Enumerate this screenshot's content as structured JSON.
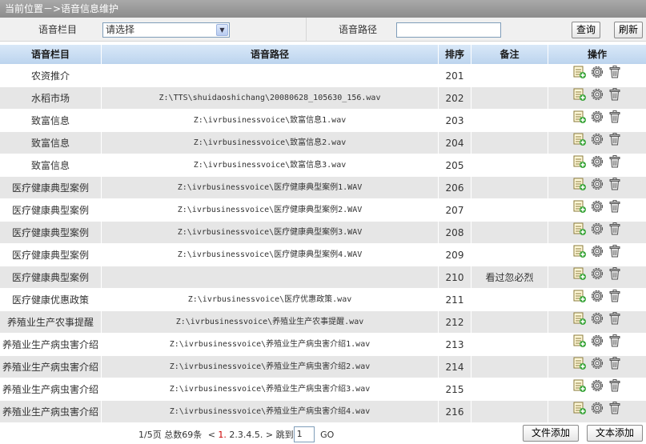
{
  "title": "当前位置－>语音信息维护",
  "filter": {
    "category_label": "语音栏目",
    "category_value": "请选择",
    "path_label": "语音路径",
    "path_value": "",
    "query_btn": "查询",
    "refresh_btn": "刷新"
  },
  "table": {
    "headers": [
      "语音栏目",
      "语音路径",
      "排序",
      "备注",
      "操作"
    ],
    "rows": [
      {
        "category": "农资推介",
        "path": "",
        "order": "201",
        "note": ""
      },
      {
        "category": "水稻市场",
        "path": "Z:\\TTS\\shuidaoshichang\\20080628_105630_156.wav",
        "order": "202",
        "note": ""
      },
      {
        "category": "致富信息",
        "path": "Z:\\ivrbusinessvoice\\致富信息1.wav",
        "order": "203",
        "note": ""
      },
      {
        "category": "致富信息",
        "path": "Z:\\ivrbusinessvoice\\致富信息2.wav",
        "order": "204",
        "note": ""
      },
      {
        "category": "致富信息",
        "path": "Z:\\ivrbusinessvoice\\致富信息3.wav",
        "order": "205",
        "note": ""
      },
      {
        "category": "医疗健康典型案例",
        "path": "Z:\\ivrbusinessvoice\\医疗健康典型案例1.WAV",
        "order": "206",
        "note": ""
      },
      {
        "category": "医疗健康典型案例",
        "path": "Z:\\ivrbusinessvoice\\医疗健康典型案例2.WAV",
        "order": "207",
        "note": ""
      },
      {
        "category": "医疗健康典型案例",
        "path": "Z:\\ivrbusinessvoice\\医疗健康典型案例3.WAV",
        "order": "208",
        "note": ""
      },
      {
        "category": "医疗健康典型案例",
        "path": "Z:\\ivrbusinessvoice\\医疗健康典型案例4.WAV",
        "order": "209",
        "note": ""
      },
      {
        "category": "医疗健康典型案例",
        "path": "",
        "order": "210",
        "note": "看过忽必烈"
      },
      {
        "category": "医疗健康优惠政策",
        "path": "Z:\\ivrbusinessvoice\\医疗优惠政策.wav",
        "order": "211",
        "note": ""
      },
      {
        "category": "养殖业生产农事提醒",
        "path": "Z:\\ivrbusinessvoice\\养殖业生产农事提醒.wav",
        "order": "212",
        "note": ""
      },
      {
        "category": "养殖业生产病虫害介绍",
        "path": "Z:\\ivrbusinessvoice\\养殖业生产病虫害介绍1.wav",
        "order": "213",
        "note": ""
      },
      {
        "category": "养殖业生产病虫害介绍",
        "path": "Z:\\ivrbusinessvoice\\养殖业生产病虫害介绍2.wav",
        "order": "214",
        "note": ""
      },
      {
        "category": "养殖业生产病虫害介绍",
        "path": "Z:\\ivrbusinessvoice\\养殖业生产病虫害介绍3.wav",
        "order": "215",
        "note": ""
      },
      {
        "category": "养殖业生产病虫害介绍",
        "path": "Z:\\ivrbusinessvoice\\养殖业生产病虫害介绍4.wav",
        "order": "216",
        "note": ""
      }
    ],
    "action_icons": [
      "edit-note-icon",
      "gear-icon",
      "trash-icon"
    ]
  },
  "footer": {
    "page_info": "1/5页 总数69条",
    "prev_symbol": "<",
    "current_page": "1.",
    "other_pages": "2.3.4.5.",
    "next_symbol": ">",
    "jump_label": "跳到",
    "jump_value": "1",
    "go_label": "GO",
    "file_add_btn": "文件添加",
    "text_add_btn": "文本添加"
  },
  "colors": {
    "titlebar": "#8c8c8c",
    "header": "#bcd4ee",
    "row_alt": "#e6e6e6",
    "page_current": "#cc0000"
  }
}
